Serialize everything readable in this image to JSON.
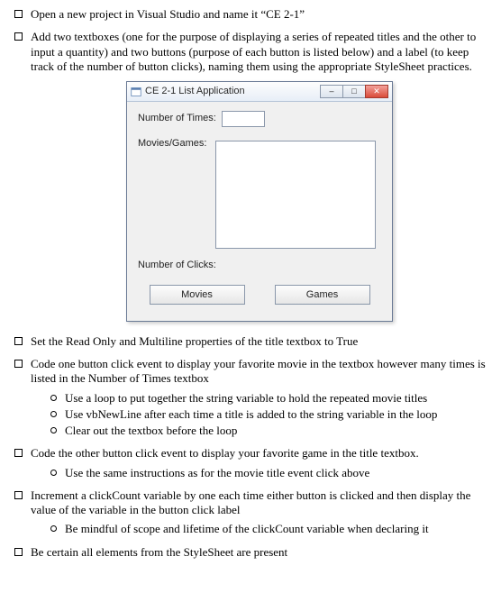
{
  "bullets": {
    "b1": "Open a new project in Visual Studio and name it “CE 2-1”",
    "b2": "Add two textboxes (one for the purpose of displaying a series of repeated titles and the other to input a quantity) and two buttons (purpose of each button is listed below) and a label (to keep track of the number of button clicks), naming them using the appropriate StyleSheet practices.",
    "b3": "Set the Read Only and Multiline properties of the title textbox to True",
    "b4": "Code one button click event to display your favorite movie in the textbox however many times is listed in the Number of Times textbox",
    "b4_sub": {
      "s1": "Use a loop to put together the string variable to hold the repeated movie titles",
      "s2": "Use vbNewLine after each time a title is added to the string variable in the loop",
      "s3": "Clear out the textbox before the loop"
    },
    "b5": "Code the other button click event to display your favorite game in the title textbox.",
    "b5_sub": {
      "s1": "Use the same instructions as for the movie title event click above"
    },
    "b6": "Increment a clickCount variable by one each time either button is clicked and then display the value of the variable in the button click label",
    "b6_sub": {
      "s1": "Be mindful of scope and lifetime of the clickCount variable when declaring it"
    },
    "b7": "Be certain all elements from the StyleSheet are present"
  },
  "app": {
    "title": "CE 2-1 List Application",
    "label_times": "Number of Times:",
    "label_movies": "Movies/Games:",
    "label_clicks": "Number of Clicks:",
    "btn_movies": "Movies",
    "btn_games": "Games",
    "times_value": "",
    "list_value": "",
    "min_glyph": "–",
    "max_glyph": "□",
    "close_glyph": "✕"
  }
}
